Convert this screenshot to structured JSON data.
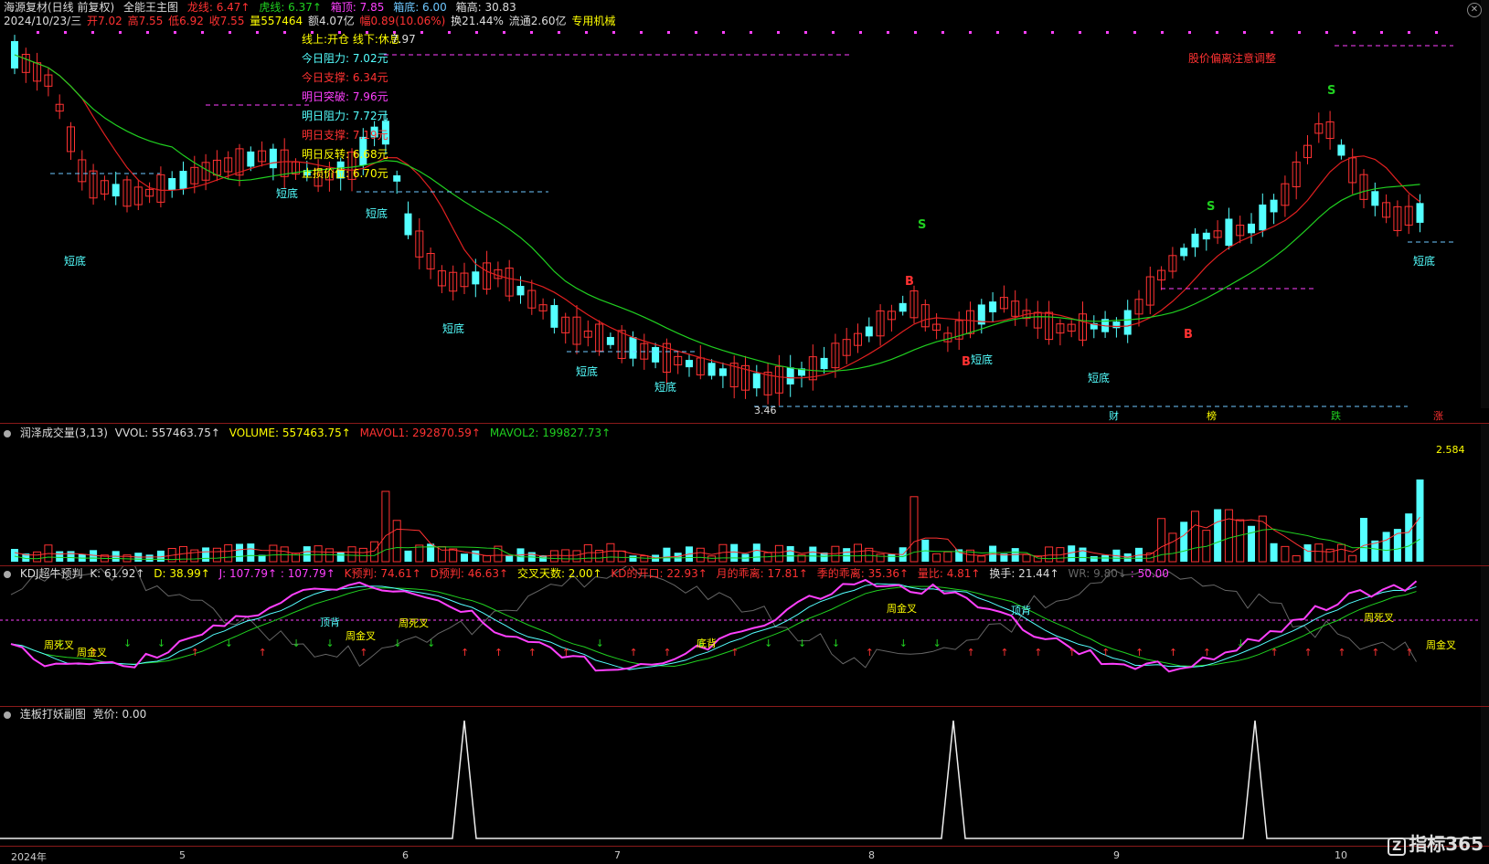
{
  "main": {
    "title": "海源复材(日线 前复权)",
    "indicator": "全能王主图",
    "dragon_line": "龙线: 6.47↑",
    "tiger_line": "虎线: 6.37↑",
    "box_top": "箱顶: 7.85",
    "box_bottom": "箱底: 6.00",
    "box_high": "箱高: 30.83",
    "date": "2024/10/23/三",
    "open": "开7.02",
    "high": "高7.55",
    "low": "低6.92",
    "close": "收7.55",
    "vol": "量557464",
    "amount": "额4.07亿",
    "change": "幅0.89(10.06%)",
    "turnover": "换21.44%",
    "float": "流通2.60亿",
    "tag": "专用机械"
  },
  "info_box": {
    "line1": "线上:开仓  线下:休息",
    "line1_val": "7.97",
    "today_resist": "今日阻力: 7.02元",
    "today_support": "今日支撑: 6.34元",
    "tomorrow_break": "明日突破: 7.96元",
    "tomorrow_resist": "明日阻力: 7.72元",
    "tomorrow_support": "明日支撑: 7.19元",
    "tomorrow_reverse": "明日反转: 6.68元",
    "stop_loss": "止损价位: 6.70元"
  },
  "warning": "股价偏离注意调整",
  "low_price": "3.46",
  "events": [
    "财",
    "榜",
    "跌",
    "涨"
  ],
  "signals": {
    "short_bottom": "短底",
    "sell": "S",
    "buy": "B"
  },
  "volume": {
    "name": "润泽成交量(3,13)",
    "vvol": "VVOL: 557463.75↑",
    "volume": "VOLUME: 557463.75↑",
    "mavol1": "MAVOL1: 292870.59↑",
    "mavol2": "MAVOL2: 199827.73↑",
    "max": "2.584"
  },
  "kdj": {
    "name": "KDJ超牛预判",
    "k": "K: 61.92↑",
    "d": "D: 38.99↑",
    "j": "J: 107.79↑",
    "jv": ": 107.79↑",
    "kp": "K预判: 74.61↑",
    "dp": "D预判: 46.63↑",
    "cross_days": "交叉天数: 2.00↑",
    "kd_open": "KD的开口: 22.93↑",
    "month": "月的乖离: 17.81↑",
    "season": "季的乖离: 35.36↑",
    "ratio": "量比: 4.81↑",
    "hand": "换手: 21.44↑",
    "wr": "WR: 9.80↓",
    "fifty": ": 50.00",
    "labels": [
      "周死叉",
      "周金叉",
      "顶背",
      "周金叉",
      "周死叉",
      "底背",
      "周金叉",
      "顶背",
      "周死叉",
      "周金叉"
    ]
  },
  "limit": {
    "name": "连板打妖副图",
    "bid": "竞价: 0.00"
  },
  "axis": [
    "2024年",
    "5",
    "6",
    "7",
    "8",
    "9",
    "10"
  ],
  "logo": "指标365",
  "colors": {
    "up": "#ff3232",
    "down": "#54ffff",
    "dragon": "#e02020",
    "tiger": "#20d020"
  }
}
